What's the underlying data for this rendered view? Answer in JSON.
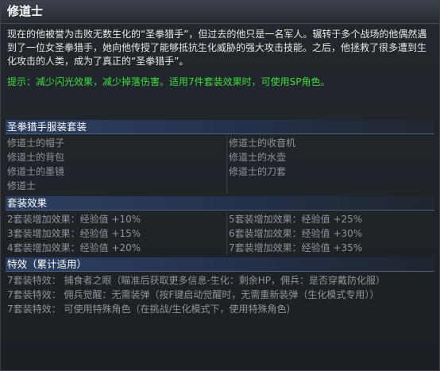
{
  "title": "修道士",
  "description": "现在的他被誉为击败无数生化的“圣拳猎手”，但过去的他只是一名军人。辗转于多个战场的他偶然遇到了一位女圣拳猎手，她向他传授了能够抵抗生化威胁的强大攻击技能。之后，他拯救了很多遭到生化攻击的人类，成为了真正的“圣拳猎手”。",
  "hint": "提示：减少闪光效果，减少掉落伤害。适用7件套装效果时，可使用SP角色。",
  "set_items": {
    "header": "圣拳猎手服装套装",
    "left": [
      "修道士的帽子",
      "修道士的背包",
      "修道士的墨镜",
      "修道士"
    ],
    "right": [
      "修道士的收音机",
      "修道士的水壶",
      "修道士的刀套"
    ]
  },
  "set_effects": {
    "header": "套装效果",
    "left": [
      "2套装增加效果：经验值 +10%",
      "3套装增加效果：经验值 +15%",
      "4套装增加效果：经验值 +20%"
    ],
    "right": [
      "5套装增加效果：经验值 +25%",
      "6套装增加效果：经验值 +30%",
      "7套装增加效果：经验值 +35%"
    ]
  },
  "special": {
    "header": "特效（累计适用）",
    "lines": [
      "7套装特效：  捕食者之眼（瞄准后获取更多信息-生化：剩余HP，佣兵：是否穿戴防化服）",
      "7套装特效：  佣兵觉醒：无需装弹（按F键启动觉醒时，无需重新装弹（生化模式专用））",
      "7套装特效：  可使用特殊角色（在挑战/生化模式下，使用特殊角色）"
    ]
  },
  "colors": {
    "hint_green": "#3fdc3f",
    "header_blue": "#2c3f63",
    "muted_gray": "#8e949b"
  }
}
